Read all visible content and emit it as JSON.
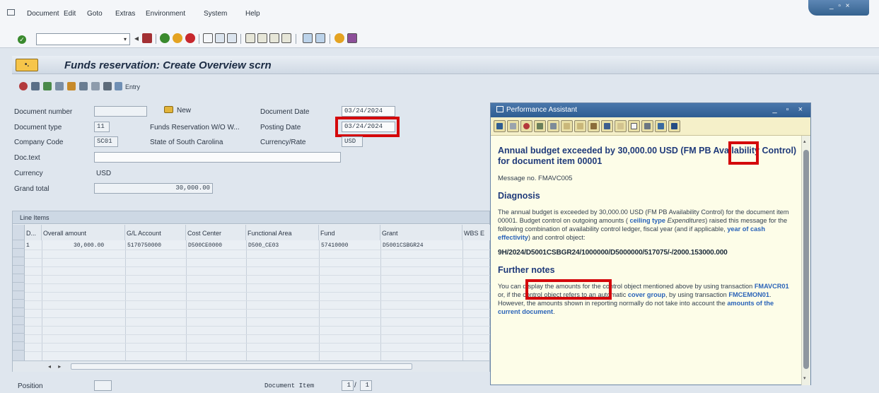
{
  "menubar": {
    "items": [
      "Document",
      "Edit",
      "Goto",
      "Extras",
      "Environment",
      "System",
      "Help"
    ]
  },
  "toolbar": {
    "command_value": ""
  },
  "titlebar": {
    "title": "Funds reservation: Create Overview scrn"
  },
  "app_toolbar": {
    "entry_label": "Entry"
  },
  "header": {
    "document_number_label": "Document number",
    "document_number": "",
    "new_label": "New",
    "document_date_label": "Document Date",
    "document_date": "03/24/2024",
    "document_type_label": "Document type",
    "document_type": "11",
    "document_type_text": "Funds Reservation W/O W...",
    "posting_date_label": "Posting Date",
    "posting_date": "03/24/2024",
    "company_code_label": "Company Code",
    "company_code": "SC01",
    "company_name": "State of South Carolina",
    "currency_rate_label": "Currency/Rate",
    "currency_rate": "USD",
    "doc_text_label": "Doc.text",
    "doc_text": "",
    "currency_label": "Currency",
    "currency": "USD",
    "grand_total_label": "Grand total",
    "grand_total": "30,000.00"
  },
  "line_items": {
    "tab_label": "Line Items",
    "columns": [
      "D...",
      "Overall amount",
      "G/L Account",
      "Cost Center",
      "Functional Area",
      "Fund",
      "Grant",
      "WBS E"
    ],
    "rows": [
      [
        "1",
        "30,000.00",
        "5170750000",
        "D500CE0000",
        "D500_CE03",
        "57410000",
        "D5001CSBGR24",
        ""
      ]
    ]
  },
  "footer": {
    "position_label": "Position",
    "document_item_label": "Document Item",
    "item_current": "1",
    "item_total": "1"
  },
  "assistant": {
    "window_title": "Performance Assistant",
    "heading": "Annual budget exceeded by 30,000.00 USD (FM PB Availability Control) for document item 00001",
    "message_no": "Message no. FMAVC005",
    "diagnosis_title": "Diagnosis",
    "diagnosis_p1": "The annual budget is exceeded by 30,000.00 USD (FM PB Availability Control) for the document item 00001. Budget control on outgoing amounts (",
    "diagnosis_link1": "ceiling type",
    "diagnosis_em": "Expenditures",
    "diagnosis_p2": ") raised this message for the following combination of availability control ledger, fiscal year (and if applicable,",
    "diagnosis_link2": "year of cash effectivity",
    "diagnosis_p3": ") and control object:",
    "control_object": "9H/2024/D5001CSBGR24/1000000/D5000000/517075/-/2000.153000.000",
    "further_title": "Further notes",
    "notes_p1": "You can display the amounts for the control object mentioned above by using transaction",
    "notes_link1": "FMAVCR01",
    "notes_p2": "or, if the control object refers to an automatic",
    "notes_link2": "cover group",
    "notes_p3": ", by using transaction",
    "notes_link3": "FMCEMON01",
    "notes_p4": ". However, the amounts shown in reporting normally do not take into account the",
    "notes_link4": "amounts of the current document",
    "notes_p5": "."
  }
}
